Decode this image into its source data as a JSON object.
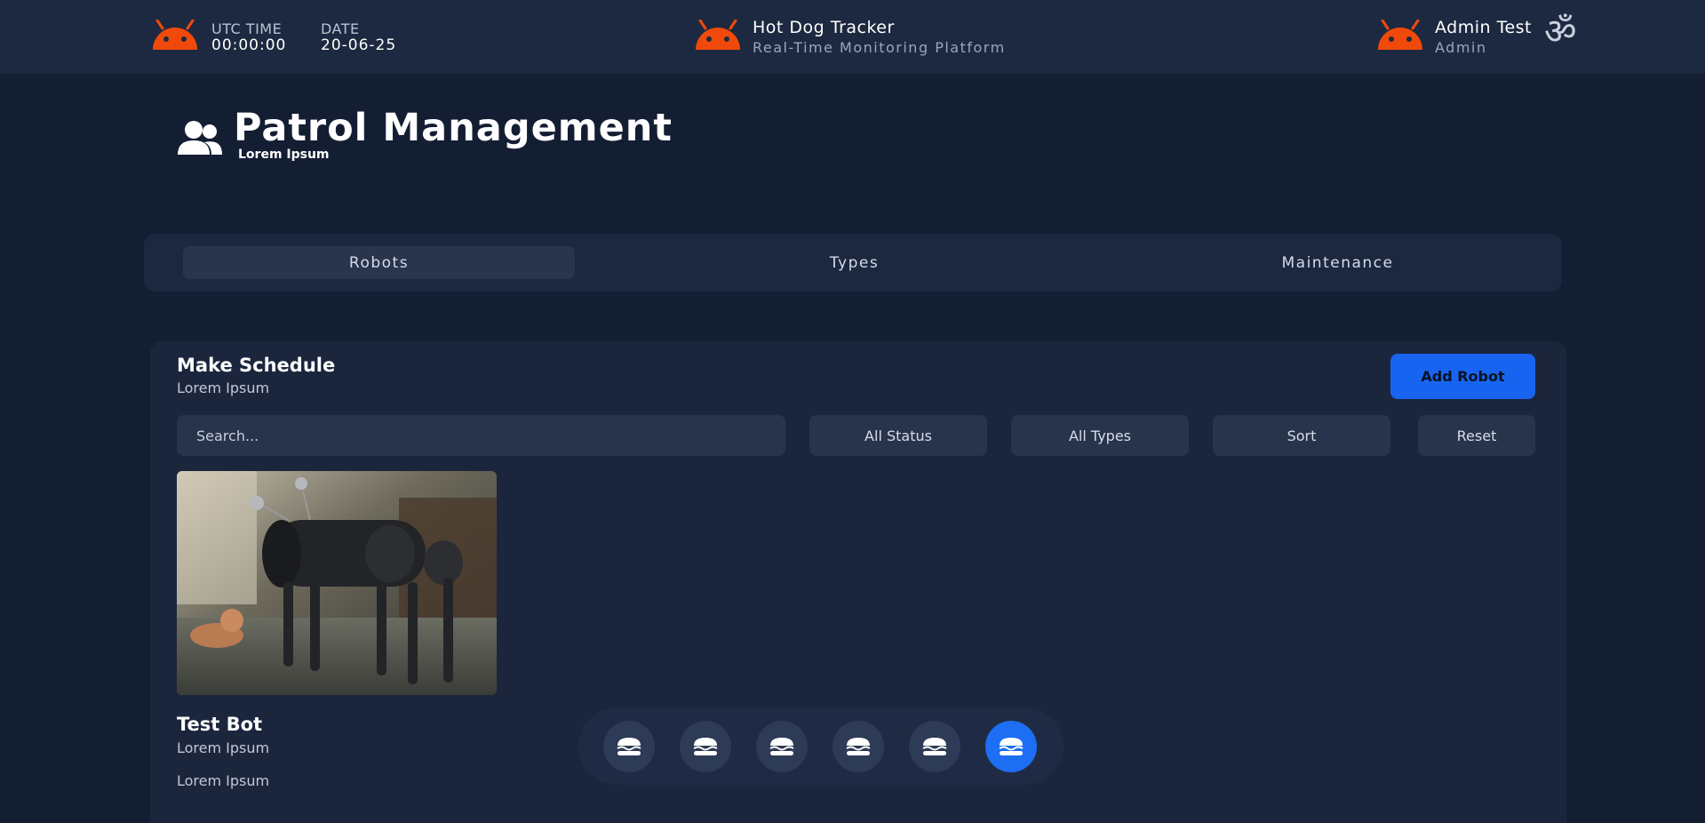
{
  "header": {
    "utc_label": "UTC TIME",
    "utc_value": "00:00:00",
    "date_label": "DATE",
    "date_value": "20-06-25",
    "app_title": "Hot Dog Tracker",
    "app_subtitle": "Real-Time Monitoring Platform",
    "user_name": "Admin Test",
    "user_role": "Admin",
    "settings_glyph": "ॐ",
    "logo_icon": "android-icon",
    "brand_color": "#f04a0a"
  },
  "page": {
    "title": "Patrol Management",
    "subtitle": "Lorem Ipsum",
    "icon": "users-icon"
  },
  "tabs": [
    {
      "label": "Robots",
      "active": true
    },
    {
      "label": "Types",
      "active": false
    },
    {
      "label": "Maintenance",
      "active": false
    }
  ],
  "panel": {
    "title": "Make Schedule",
    "subtitle": "Lorem Ipsum",
    "add_label": "Add Robot",
    "accent": "#1764f0"
  },
  "filters": {
    "search_placeholder": "Search...",
    "status": "All Status",
    "types": "All Types",
    "sort": "Sort",
    "reset": "Reset"
  },
  "robot": {
    "name": "Test Bot",
    "line1": "Lorem Ipsum",
    "line2": "Lorem Ipsum"
  },
  "dock": {
    "icon": "burger-icon",
    "count": 6,
    "active_index": 5
  }
}
